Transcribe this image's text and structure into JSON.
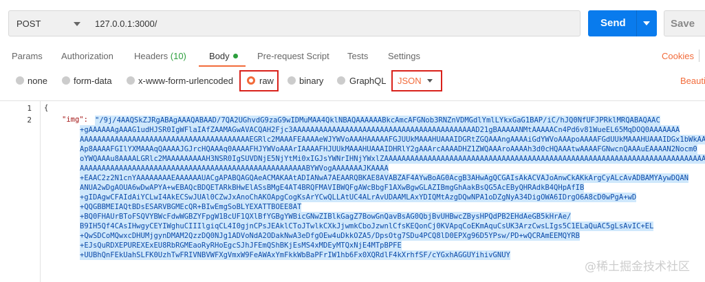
{
  "request": {
    "method": "POST",
    "url": "127.0.0.1:3000/",
    "send_label": "Send",
    "save_label": "Save"
  },
  "tabs": [
    {
      "label": "Params"
    },
    {
      "label": "Authorization"
    },
    {
      "label": "Headers",
      "count": "(10)"
    },
    {
      "label": "Body",
      "active": true
    },
    {
      "label": "Pre-request Script"
    },
    {
      "label": "Tests"
    },
    {
      "label": "Settings"
    }
  ],
  "cookies_label": "Cookies",
  "body_types": [
    {
      "label": "none"
    },
    {
      "label": "form-data"
    },
    {
      "label": "x-www-form-urlencoded"
    },
    {
      "label": "raw",
      "selected": true
    },
    {
      "label": "binary"
    },
    {
      "label": "GraphQL"
    }
  ],
  "format_select": "JSON",
  "beautify_label": "Beautif",
  "editor": {
    "line_numbers": [
      "1",
      "2"
    ],
    "open_brace": "{",
    "key": "\"img\":",
    "value_lines": [
      "\"/9j/4AAQSkZJRgABAgAAAQABAAD/7QA2UGhvdG9zaG9wIDMuMAA4QklNBAQAAAAAABkcAmcAFGNob3RNZnVDMGdlYmlLYkxGaG1BAP/iC/hJQ0NfUFJPRklMRQABAQAAC",
      "+gAAAAAAgAAAG1udHJSR0IgWFlaIAfZAAMAGwAVACQAH2Fjc3AAAAAAAAAAAAAAAAAAAAAAAAAAAAAAAAAAAAAAAAAAD21gBAAAAANMtAAAAACn4Pd6v81WueEL65MqDOQ0AAAAAAA",
      "AAAAAAAAAAAAAAAAAAAAAAAAAAAAAAAAAAAAAAAEGRlc2MAAAFEAAAAeWJYWVoAAAHAAAAAFGJUUkMAAAHUAAAIDGRtZGQAAAngAAAAiGdYWVoAAApoAAAAFGdUUkMAAAHUAAAIDGx1bWkAAA",
      "Ap8AAAAFGIlYXMAAAqQAAAAJGJrcHQAAAq0AAAAFHJYWVoAAArIAAAAFHJUUkMAAAHUAAAIDHRlY2gAAArcAAAADHZ1ZWQAAAroAAAAh3d0cHQAAAtwAAAAFGNwcnQAAAuEAAAAN2Nocm0",
      "oYWQAAAu8AAAALGRlc2MAAAAAAAAAH3NSR0IgSUVDNjE5NjYtMi0xIGJsYWNrIHNjYWxlZAAAAAAAAAAAAAAAAAAAAAAAAAAAAAAAAAAAAAAAAAAAAAAAAAAAAAAAAAAAAAAAAAAAAAAAAAAAAA",
      "AAAAAAAAAAAAAAAAAAAAAAAAAAAAAAAAAAAAAAAAAAAAAAAAAAAABYWVogAAAAAAAJKAAAA",
      "+EAAC2z2N1cnYAAAAAAAAEAAAAAAUACgAPABQAGQAeACMAKAAtADIANwA7AEAARQBKAE8AVABZAF4AYwBoAG0AcgB3AHwAgQCGAIsAkACVAJoAnwCkAKkArgCyALcAvADBAMYAywDQAN",
      "ANUA2wDgAOUA6wDwAPYA+wEBAQcBDQETARkBHwElASsBMgE4AT4BRQFMAVIBWQFgAWcBbgF1AXwBgwGLAZIBmgGhAakBsQG5AcEByQHRAdkB4QHpAfIB",
      "+gIDAgwCFAIdAiYCLwI4AkECSwJUAl0CZwJxAnoChAKOApgCogKsArYCwQLLAtUC4ALrAvUDAAMLAxYDIQMtAzgDQwNPA1oDZgNyA34DigOWA6IDrgO6A8cD0wPgA+wD",
      "+QQGBBMEIAQtBDsESARVBGMEcQR+BIwEmgSoBLYEXATTBOEE8AT",
      "+BQ0FHAUrBToFSQVYBWcFdwWGBZYFpgW1BcUF1QXlBfYGBgYWBicGNwZIBlkGagZ7BowGnQavBsAG0QbjBvUHBwcZBysHPQdPB2EHdAeGB5kHrAe/",
      "B9IH5Qf4CAsIHwgyCEYIWghuCIIIlgiqCL4I0gjnCPsJEAklCToJTwlkCXkJjwmkCboJzwnlCfsKEQonCj0KVApqCoEKmAquCsUK3ArzCwsLIgs5C1ELaQuAC5gLsAvIC+EL",
      "+QwSDCoMQwxcDHUMjgynDMAM2QzzDQ0NJg1ADVoNdA2ODakNwA3eDfgOEw4uDkkOZA5/DpsOtg7SDu4PCQ8lD0EPXg96D5YPsw/PD+wQCRAmEEMQYRB",
      "+EJsQuRDXEPUREXExEU8RbRGMEaoRyRHoEgcSJhJFEmQShBKjEsMS4xMDEyMTQxNjE4MTpBPFE",
      "+UUBhQnFEkUahSLFK0UzhTwFRIVNBVWFXgVmxW9FeAWAxYmFkkWbBaPFrIW1hb6Fx0XQRdlF4kXrhfSF/cYGxhAGGUYihivGNUY"
    ]
  },
  "watermark": "@稀土掘金技术社区"
}
